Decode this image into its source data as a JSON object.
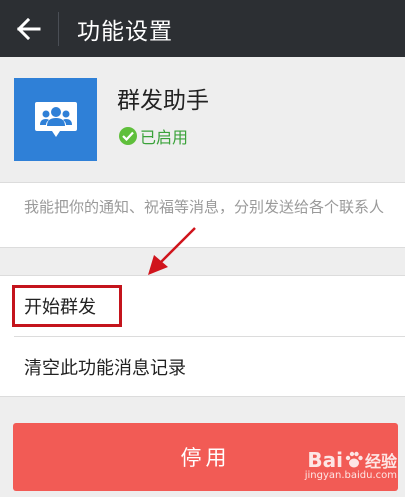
{
  "topbar": {
    "title": "功能设置",
    "back_icon": "arrow-left-icon"
  },
  "app": {
    "name": "群发助手",
    "status": "已启用",
    "icon": "group-chat-icon",
    "icon_color": "#2f80d7",
    "status_color": "#3aa23a"
  },
  "description": "我能把你的通知、祝福等消息，分别发送给各个联系人",
  "menu": [
    {
      "label": "开始群发"
    },
    {
      "label": "清空此功能消息记录"
    }
  ],
  "disable_button": {
    "label": "停用",
    "color": "#f25b55"
  },
  "watermark": {
    "brand": "Bai",
    "brand_suffix": "经验",
    "url": "jingyan.baidu.com"
  }
}
